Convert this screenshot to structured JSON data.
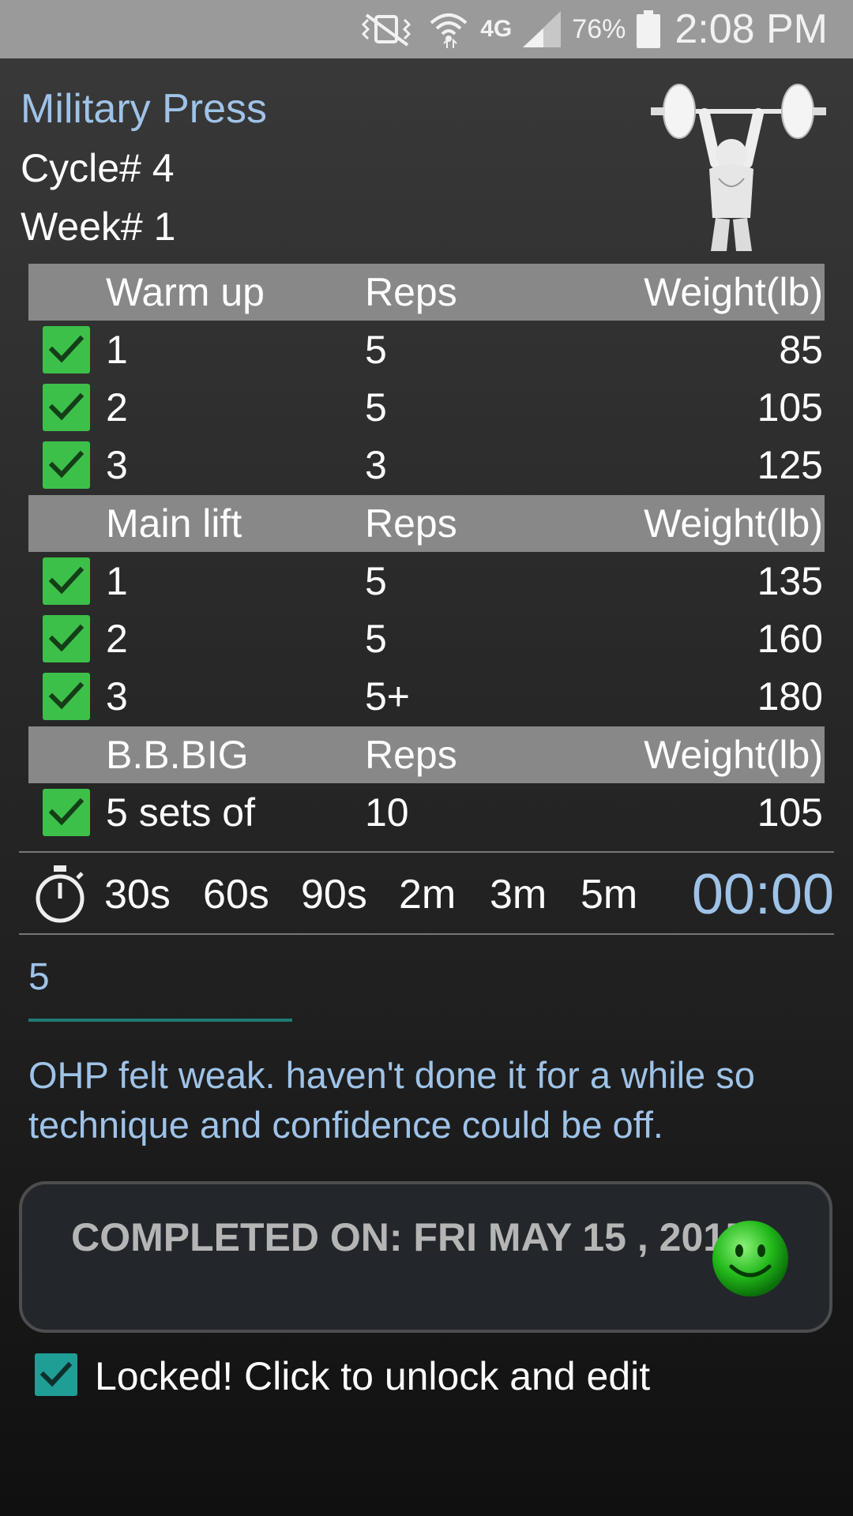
{
  "status_bar": {
    "battery_percent": "76%",
    "time": "2:08 PM",
    "network": "4G",
    "icons": [
      "mute-vibrate-icon",
      "wifi-icon",
      "lte-icon",
      "signal-icon",
      "battery-icon"
    ]
  },
  "exercise": {
    "title": "Military Press",
    "cycle": "Cycle# 4",
    "week": "Week# 1"
  },
  "sections": [
    {
      "header": {
        "name": "Warm up",
        "reps": "Reps",
        "weight": "Weight(lb)"
      },
      "rows": [
        {
          "set": "1",
          "reps": "5",
          "weight": "85",
          "checked": true
        },
        {
          "set": "2",
          "reps": "5",
          "weight": "105",
          "checked": true
        },
        {
          "set": "3",
          "reps": "3",
          "weight": "125",
          "checked": true
        }
      ]
    },
    {
      "header": {
        "name": "Main lift",
        "reps": "Reps",
        "weight": "Weight(lb)"
      },
      "rows": [
        {
          "set": "1",
          "reps": "5",
          "weight": "135",
          "checked": true
        },
        {
          "set": "2",
          "reps": "5",
          "weight": "160",
          "checked": true
        },
        {
          "set": "3",
          "reps": "5+",
          "weight": "180",
          "checked": true
        }
      ]
    },
    {
      "header": {
        "name": "B.B.BIG",
        "reps": "Reps",
        "weight": "Weight(lb)"
      },
      "rows": [
        {
          "set": "5 sets of",
          "reps": "10",
          "weight": "105",
          "checked": true
        }
      ]
    }
  ],
  "timer": {
    "presets": [
      "30s",
      "60s",
      "90s",
      "2m",
      "3m",
      "5m"
    ],
    "display": "00:00"
  },
  "notes": {
    "amrap_reps": "5",
    "text": "OHP felt weak. haven't done it for a while so technique and confidence could be off."
  },
  "completion": {
    "label": "COMPLETED ON: FRI MAY 15 , 2015",
    "mood": "happy-smiley-icon"
  },
  "lock": {
    "label": "Locked! Click to unlock and edit",
    "checked": true
  },
  "colors": {
    "accent_blue": "#9fc3e8",
    "check_green": "#3cc04a",
    "lock_teal": "#1f9e96",
    "header_gray": "#888888"
  }
}
